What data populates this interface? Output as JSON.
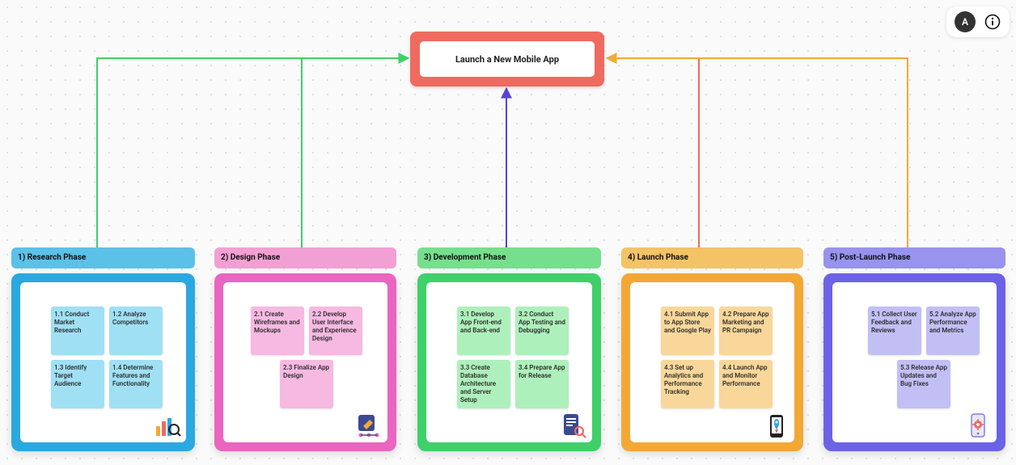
{
  "toolbar": {
    "avatar_initial": "A"
  },
  "root": {
    "title": "Launch a New Mobile App"
  },
  "chart_data": {
    "type": "tree",
    "root": "Launch a New Mobile App",
    "phases": [
      {
        "id": "p1",
        "title": "1) Research Phase",
        "color": "#29a9df",
        "tasks": [
          "1.1 Conduct Market Research",
          "1.2 Analyze Competitors",
          "1.3 Identify Target Audience",
          "1.4 Determine Features and Functionality"
        ],
        "icon": "analytics-icon"
      },
      {
        "id": "p2",
        "title": "2) Design  Phase",
        "color": "#ea65c0",
        "tasks": [
          "2.1 Create Wireframes and Mockups",
          "2.2 Develop User Interface and Experience Design",
          "2.3 Finalize App Design"
        ],
        "icon": "design-tool-icon"
      },
      {
        "id": "p3",
        "title": "3) Development  Phase",
        "color": "#3fd06a",
        "tasks": [
          "3.1 Develop App Front-end and Back-end",
          "3.2 Conduct App Testing and Debugging",
          "3.3 Create Database Architecture and Server Setup",
          "3.4 Prepare App for Release"
        ],
        "icon": "clipboard-search-icon"
      },
      {
        "id": "p4",
        "title": "4) Launch  Phase",
        "color": "#f3a836",
        "tasks": [
          "4.1 Submit App to App Store and Google Play",
          "4.2 Prepare App Marketing and PR Campaign",
          "4.3 Set up Analytics and Performance Tracking",
          "4.4 Launch App and Monitor Performance"
        ],
        "icon": "rocket-phone-icon"
      },
      {
        "id": "p5",
        "title": "5) Post-Launch  Phase",
        "color": "#6c62e8",
        "tasks": [
          "5.1 Collect User Feedback and Reviews",
          "5.2 Analyze App Performance and Metrics",
          "5.3 Release App Updates and Bug Fixes"
        ],
        "icon": "phone-gear-icon"
      }
    ]
  },
  "phases": {
    "p1": {
      "title": "1) Research Phase",
      "t0": "1.1 Conduct Market Research",
      "t1": "1.2 Analyze Competitors",
      "t2": "1.3 Identify Target Audience",
      "t3": "1.4 Determine Features and Functionality"
    },
    "p2": {
      "title": "2) Design  Phase",
      "t0": "2.1 Create Wireframes and Mockups",
      "t1": "2.2 Develop User Interface and Experience Design",
      "t2": "2.3 Finalize App Design"
    },
    "p3": {
      "title": "3) Development  Phase",
      "t0": "3.1 Develop App Front-end and Back-end",
      "t1": "3.2 Conduct App Testing and Debugging",
      "t2": "3.3 Create Database Architecture and Server Setup",
      "t3": "3.4 Prepare App for Release"
    },
    "p4": {
      "title": "4) Launch  Phase",
      "t0": "4.1 Submit App to App Store and Google Play",
      "t1": "4.2 Prepare App Marketing and PR Campaign",
      "t2": "4.3 Set up Analytics and Performance Tracking",
      "t3": "4.4 Launch App and Monitor Performance"
    },
    "p5": {
      "title": "5) Post-Launch  Phase",
      "t0": "5.1 Collect User Feedback and Reviews",
      "t1": "5.2 Analyze App Performance and Metrics",
      "t2": "5.3 Release App Updates and Bug Fixes"
    }
  }
}
